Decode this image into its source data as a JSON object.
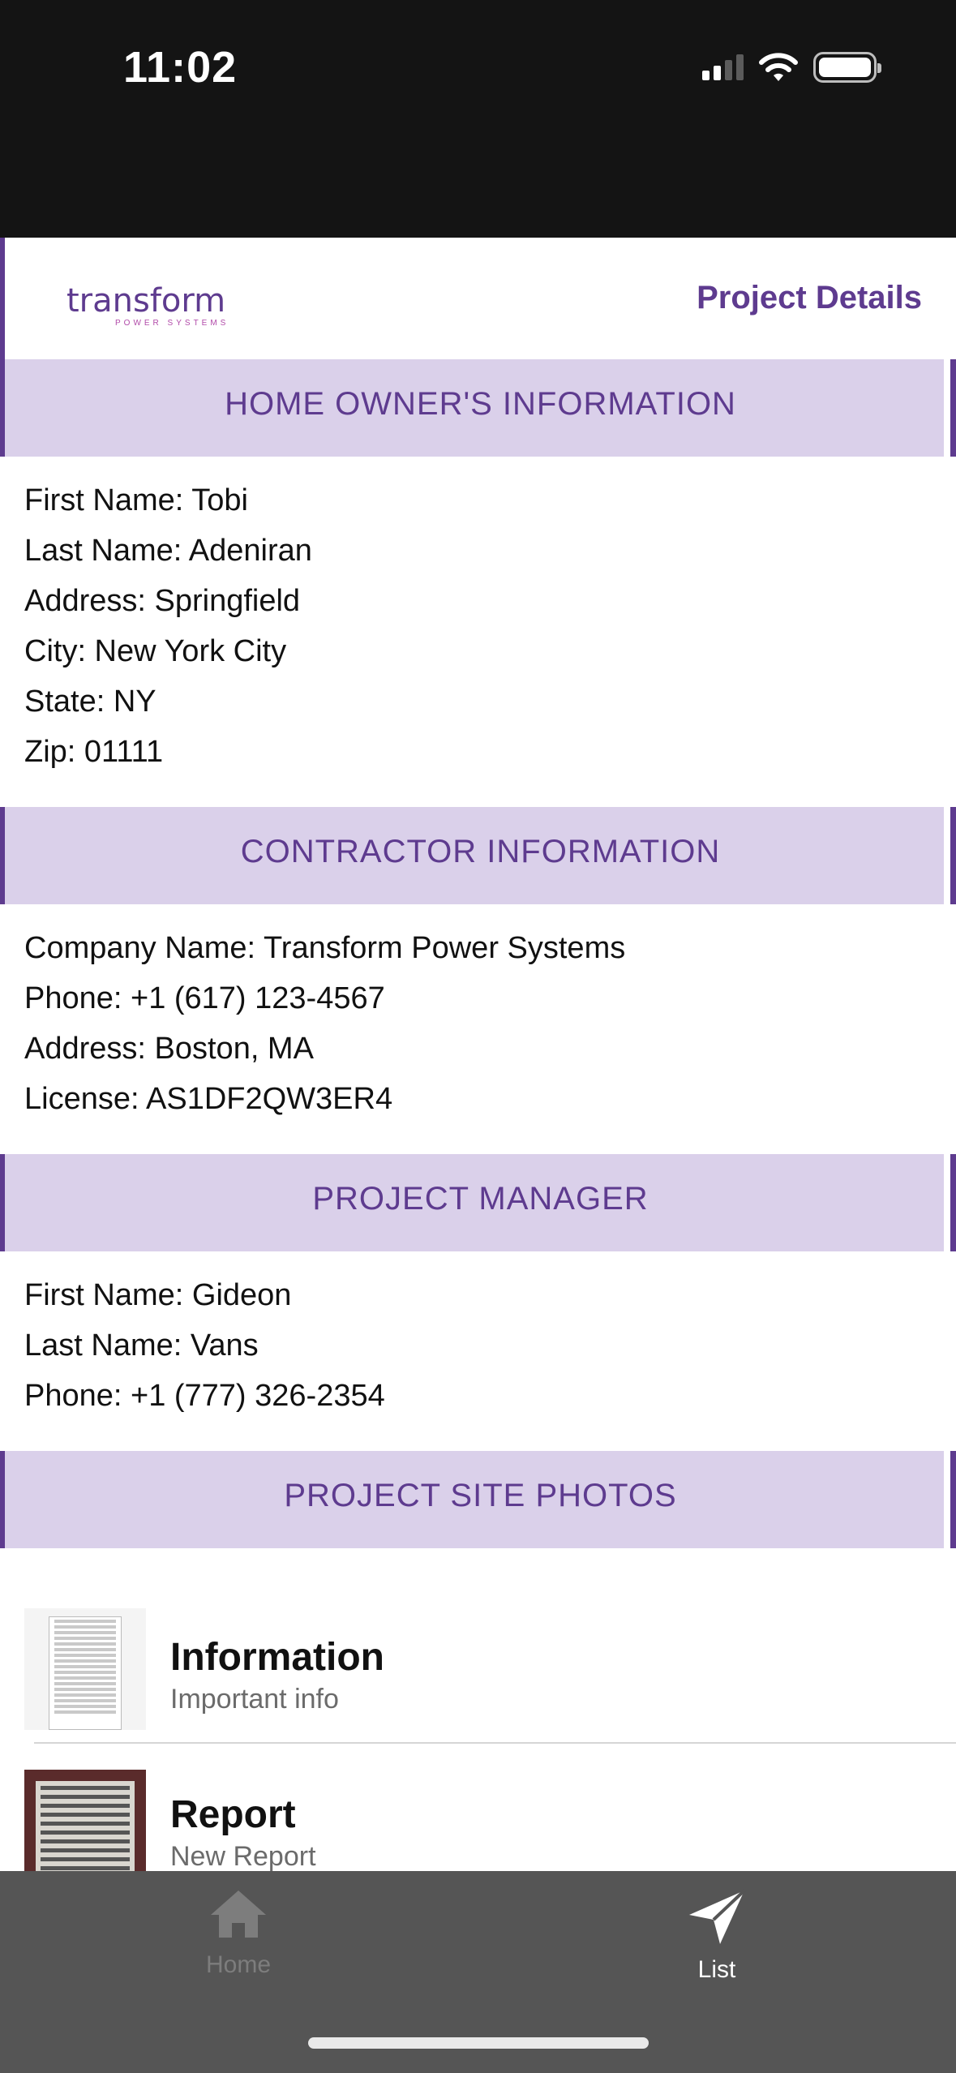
{
  "status_bar": {
    "time": "11:02"
  },
  "header": {
    "logo_text": "transform",
    "logo_subtext": "POWER SYSTEMS",
    "title": "Project Details"
  },
  "sections": {
    "home_owner": {
      "title": "HOME OWNER'S INFORMATION",
      "lines": [
        "First Name: Tobi",
        "Last Name: Adeniran",
        "Address: Springfield",
        "City: New York City",
        "State: NY",
        "Zip: 01111"
      ]
    },
    "contractor": {
      "title": "CONTRACTOR INFORMATION",
      "lines": [
        "Company Name: Transform Power Systems",
        "Phone: +1 (617) 123-4567",
        "Address: Boston, MA",
        "License: AS1DF2QW3ER4"
      ]
    },
    "project_manager": {
      "title": "PROJECT MANAGER",
      "lines": [
        "First Name: Gideon",
        "Last Name: Vans",
        "Phone: +1 (777) 326-2354"
      ]
    },
    "site_photos": {
      "title": "PROJECT SITE PHOTOS",
      "items": [
        {
          "title": "Information",
          "subtitle": "Important info"
        },
        {
          "title": "Report",
          "subtitle": "New Report"
        }
      ]
    }
  },
  "tab_bar": {
    "tabs": [
      {
        "label": "Home",
        "icon": "home-icon",
        "active": false
      },
      {
        "label": "List",
        "icon": "send-icon",
        "active": true
      }
    ]
  },
  "colors": {
    "brand_purple": "#5e3b8f",
    "banner_bg": "#dad0ea",
    "tab_bar_bg": "#555555"
  }
}
